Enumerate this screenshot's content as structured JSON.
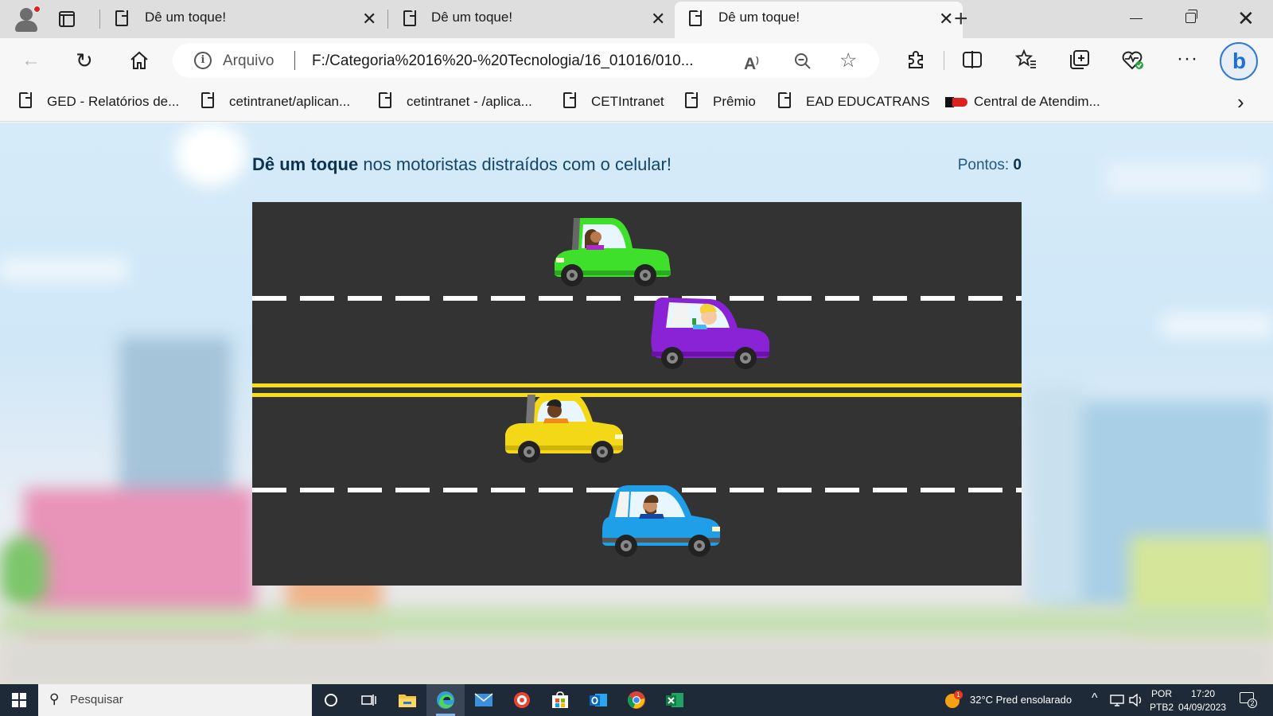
{
  "browser": {
    "tabs": [
      {
        "title": "Dê um toque!",
        "active": false
      },
      {
        "title": "Dê um toque!",
        "active": false
      },
      {
        "title": "Dê um toque!",
        "active": true
      }
    ],
    "address": {
      "label": "Arquivo",
      "url": "F:/Categoria%2016%20-%20Tecnologia/16_01016/010..."
    },
    "bookmarks": [
      {
        "label": "GED - Relatórios de...",
        "icon": "page-icon"
      },
      {
        "label": "cetintranet/aplican...",
        "icon": "page-icon"
      },
      {
        "label": "cetintranet - /aplica...",
        "icon": "page-icon"
      },
      {
        "label": "CETIntranet",
        "icon": "page-icon"
      },
      {
        "label": "Prêmio",
        "icon": "page-icon"
      },
      {
        "label": "EAD EDUCATRANS",
        "icon": "page-icon"
      },
      {
        "label": "Central de Atendim...",
        "icon": "flag-icon"
      }
    ]
  },
  "game": {
    "headline_bold": "Dê um toque",
    "headline_rest": " nos motoristas distraídos com o celular!",
    "score_label": "Pontos: ",
    "score_value": "0",
    "colors": {
      "road": "#333333",
      "lane_dash": "#ffffff",
      "center_line": "#f7dc17",
      "headline": "#12466b"
    },
    "cars": [
      {
        "color": "#3ee02b",
        "facing": "left",
        "driver": "woman with brown hair",
        "phone": false
      },
      {
        "color": "#8a22d6",
        "facing": "left",
        "driver": "blond man",
        "phone": true
      },
      {
        "color": "#f2d816",
        "facing": "right",
        "driver": "man",
        "phone": false
      },
      {
        "color": "#1f9fe8",
        "facing": "right",
        "driver": "bearded man",
        "phone": false
      }
    ]
  },
  "taskbar": {
    "search_placeholder": "Pesquisar",
    "weather": "32°C  Pred ensolarado",
    "weather_badge": "1",
    "lang_top": "POR",
    "lang_bottom": "PTB2",
    "time": "17:20",
    "date": "04/09/2023",
    "notifications": "2",
    "apps": [
      "task-view-icon",
      "file-explorer-icon",
      "edge-icon",
      "mail-icon",
      "app-icon",
      "store-icon",
      "outlook-icon",
      "chrome-icon",
      "excel-icon"
    ]
  }
}
